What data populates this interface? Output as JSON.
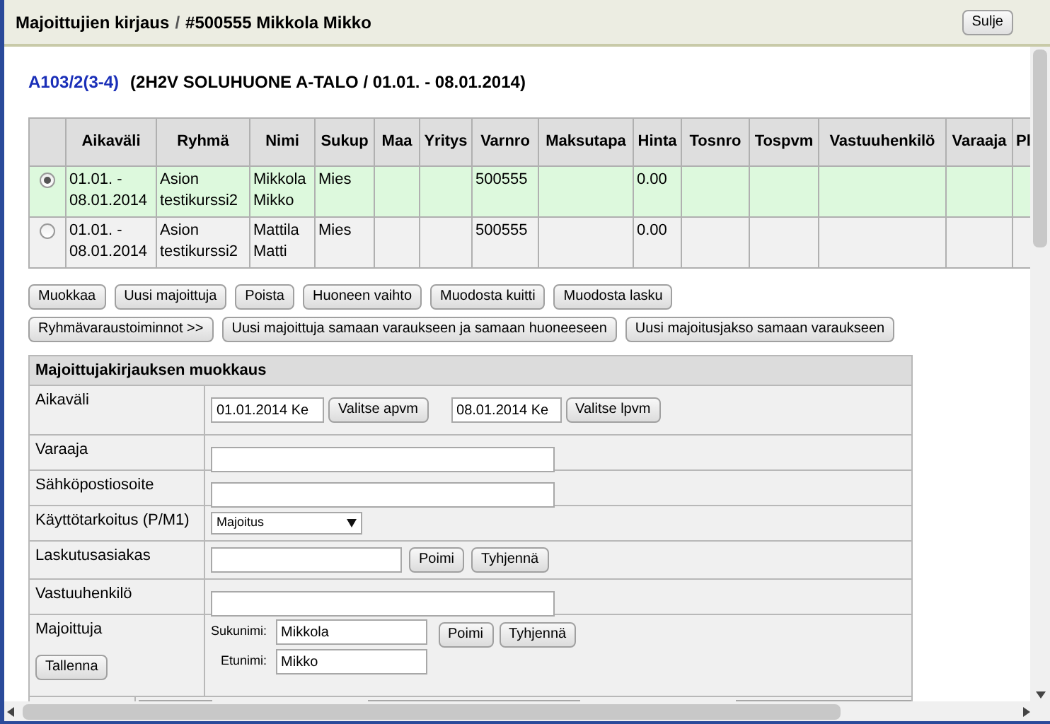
{
  "window": {
    "title": "Majoittujien kirjaus",
    "separator": "/",
    "subtitle": "#500555 Mikkola Mikko",
    "close_button": "Sulje"
  },
  "room": {
    "link": "A103/2(3-4)",
    "description": "(2H2V SOLUHUONE A-TALO / 01.01. - 08.01.2014)"
  },
  "table": {
    "columns": [
      "Aikaväli",
      "Ryhmä",
      "Nimi",
      "Sukup",
      "Maa",
      "Yritys",
      "Varnro",
      "Maksutapa",
      "Hinta",
      "Tosnro",
      "Tospvm",
      "Vastuuhenkilö",
      "Varaaja",
      "Pl"
    ],
    "rows": [
      {
        "selected": true,
        "cells": [
          "01.01. - 08.01.2014",
          "Asion testikurssi2",
          "Mikkola Mikko",
          "Mies",
          "",
          "",
          "500555",
          "",
          "0.00",
          "",
          "",
          "",
          "",
          ""
        ]
      },
      {
        "selected": false,
        "cells": [
          "01.01. - 08.01.2014",
          "Asion testikurssi2",
          "Mattila Matti",
          "Mies",
          "",
          "",
          "500555",
          "",
          "0.00",
          "",
          "",
          "",
          "",
          ""
        ]
      }
    ]
  },
  "actions_row_1": [
    "Muokkaa",
    "Uusi majoittuja",
    "Poista",
    "Huoneen vaihto",
    "Muodosta kuitti",
    "Muodosta lasku"
  ],
  "actions_row_2": [
    "Ryhmävaraustoiminnot >>",
    "Uusi majoittuja samaan varaukseen ja samaan huoneeseen",
    "Uusi majoitusjakso samaan varaukseen"
  ],
  "form": {
    "title": "Majoittujakirjauksen muokkaus",
    "rows": [
      {
        "kind": "dates",
        "label": "Aikaväli",
        "start": "01.01.2014 Ke",
        "start_button": "Valitse apvm",
        "end": "08.01.2014 Ke",
        "end_button": "Valitse lpvm"
      },
      {
        "kind": "text",
        "label": "Varaaja"
      },
      {
        "kind": "text",
        "label": "Sähköpostiosoite"
      },
      {
        "kind": "select",
        "label": "Käyttötarkoitus (P/M1)",
        "value": "Majoitus"
      },
      {
        "kind": "picker",
        "label": "Laskutusasiakas",
        "buttons": [
          "Poimi",
          "Tyhjennä"
        ]
      },
      {
        "kind": "text",
        "label": "Vastuuhenkilö"
      },
      {
        "kind": "person",
        "label": "Majoittuja",
        "save_button": "Tallenna",
        "last_name_label": "Sukunimi:",
        "last_name": "Mikkola",
        "first_name_label": "Etunimi:",
        "first_name": "Mikko",
        "buttons": [
          "Poimi",
          "Tyhjennä"
        ]
      },
      {
        "kind": "partial"
      }
    ]
  }
}
